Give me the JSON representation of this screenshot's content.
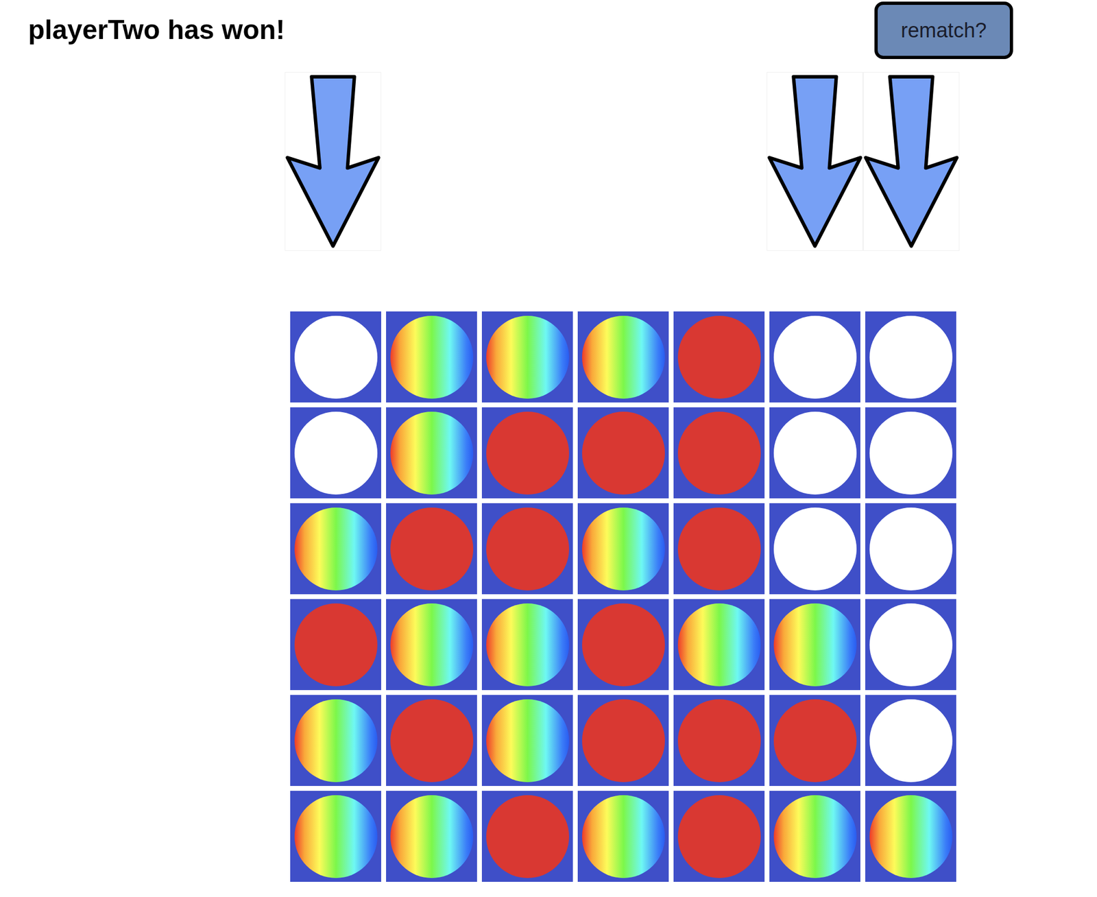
{
  "status": {
    "text": "playerTwo has won!"
  },
  "rematch_button": {
    "label": "rematch?"
  },
  "columns": [
    {
      "open": true
    },
    {
      "open": false
    },
    {
      "open": false
    },
    {
      "open": false
    },
    {
      "open": false
    },
    {
      "open": true
    },
    {
      "open": true
    }
  ],
  "board": {
    "rows": [
      [
        "empty",
        "playerTwo",
        "playerTwo",
        "playerTwo",
        "playerOne",
        "empty",
        "empty"
      ],
      [
        "empty",
        "playerTwo",
        "playerOne",
        "playerOne",
        "playerOne",
        "empty",
        "empty"
      ],
      [
        "playerTwo",
        "playerOne",
        "playerOne",
        "playerTwo",
        "playerOne",
        "empty",
        "empty"
      ],
      [
        "playerOne",
        "playerTwo",
        "playerTwo",
        "playerOne",
        "playerTwo",
        "playerTwo",
        "empty"
      ],
      [
        "playerTwo",
        "playerOne",
        "playerTwo",
        "playerOne",
        "playerOne",
        "playerOne",
        "empty"
      ],
      [
        "playerTwo",
        "playerTwo",
        "playerOne",
        "playerTwo",
        "playerOne",
        "playerTwo",
        "playerTwo"
      ]
    ]
  }
}
